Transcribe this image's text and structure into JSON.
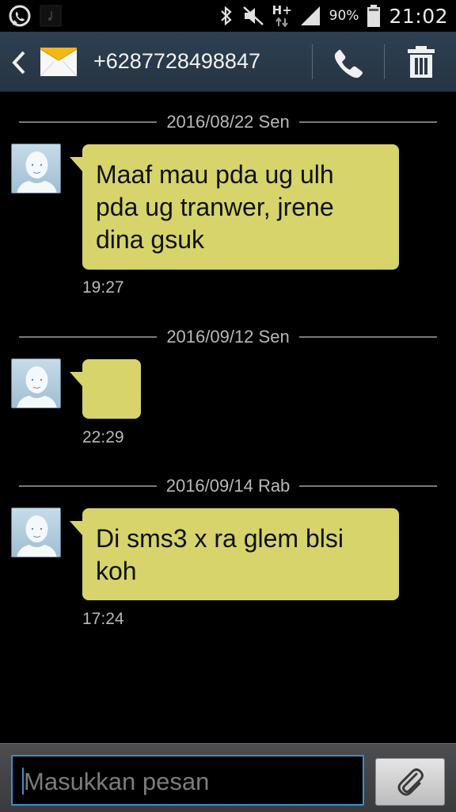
{
  "status_bar": {
    "battery_percent": "90%",
    "time": "21:02",
    "network_type": "H+",
    "icons": [
      "whatsapp-icon",
      "music-notification-icon",
      "bluetooth-icon",
      "mute-icon",
      "network-h-plus-icon",
      "signal-icon",
      "battery-icon"
    ]
  },
  "header": {
    "contact": "+6287728498847",
    "icons": [
      "back-icon",
      "envelope-icon",
      "call-icon",
      "trash-icon"
    ]
  },
  "conversation": [
    {
      "date": "2016/08/22 Sen",
      "messages": [
        {
          "text": "Maaf mau pda ug ulh\npda ug tranwer, jrene\ndina gsuk",
          "time": "19:27"
        }
      ]
    },
    {
      "date": "2016/09/12 Sen",
      "messages": [
        {
          "text": "",
          "time": "22:29"
        }
      ]
    },
    {
      "date": "2016/09/14 Rab",
      "messages": [
        {
          "text": "Di sms3 x ra glem blsi\nkoh",
          "time": "17:24"
        }
      ]
    }
  ],
  "compose": {
    "placeholder": "Masukkan pesan"
  },
  "colors": {
    "bubble": "#d6d46b",
    "action_bar": "#2e4052",
    "input_focus": "#3a8fd0"
  }
}
